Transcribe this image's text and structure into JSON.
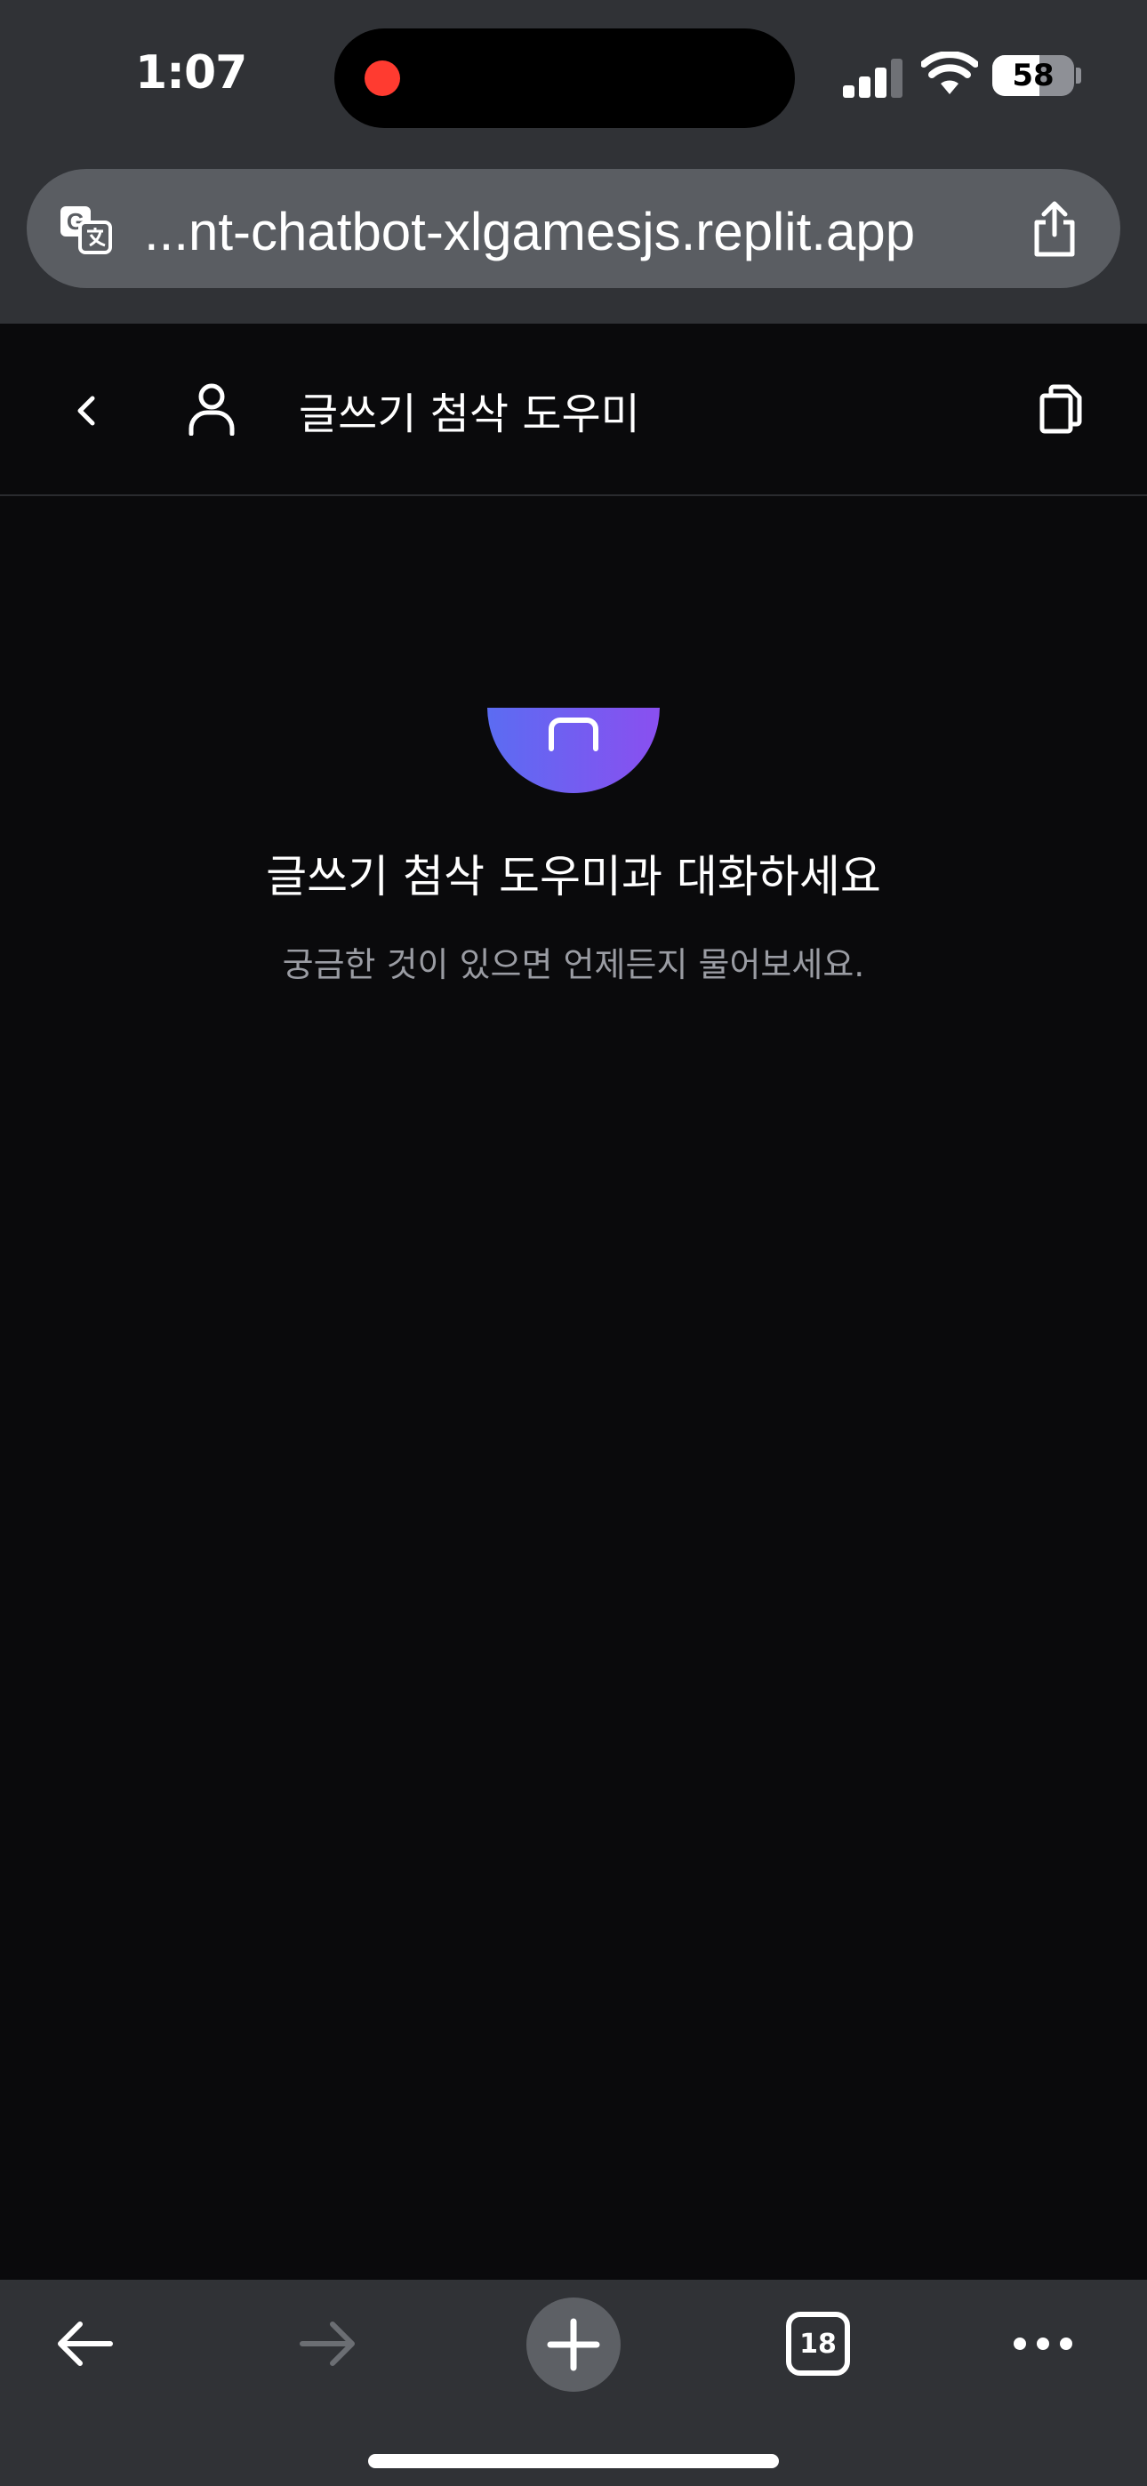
{
  "status_bar": {
    "time": "1:07",
    "battery_percent": "58",
    "battery_level": 0.58,
    "signal_bars_active": 3,
    "signal_bars_total": 4,
    "recording_color": "#ff3b30"
  },
  "browser": {
    "url": "...nt-chatbot-xlgamesjs.replit.app",
    "translate_icon": "translate-icon",
    "share_icon": "share-icon",
    "tabs_count": "18",
    "toolbar_icons": [
      "back-arrow-icon",
      "forward-arrow-icon",
      "plus-icon",
      "tabs-icon",
      "more-icon"
    ]
  },
  "header": {
    "title": "글쓰기 첨삭 도우미",
    "back_icon": "chevron-left-icon",
    "user_icon": "user-icon",
    "copy_icon": "copy-icon"
  },
  "empty_state": {
    "title": "글쓰기 첨삭 도우미과 대화하세요",
    "subtitle": "궁금한 것이 있으면 언제든지 물어보세요.",
    "avatar_gradient": [
      "#5b6cf2",
      "#8a4ff0"
    ]
  },
  "colors": {
    "background": "#0a0a0c",
    "chrome": "#303236",
    "urlbar": "#5a5d62",
    "muted_text": "#9a9ca3"
  }
}
